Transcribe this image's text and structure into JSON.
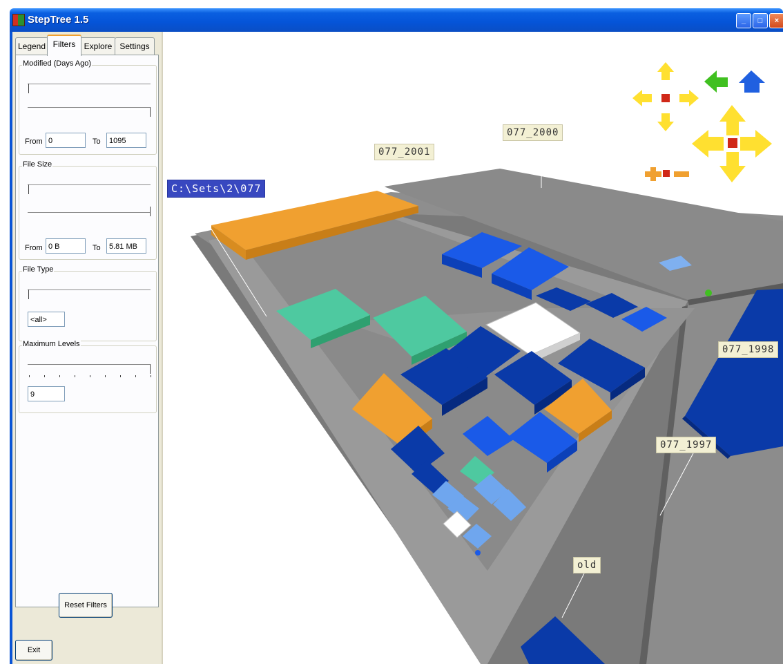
{
  "window": {
    "title": "StepTree 1.5",
    "buttons": [
      "minimize",
      "maximize",
      "close"
    ]
  },
  "tabs": [
    {
      "label": "Legend",
      "active": false
    },
    {
      "label": "Filters",
      "active": true
    },
    {
      "label": "Explore",
      "active": false
    },
    {
      "label": "Settings",
      "active": false
    }
  ],
  "filters": {
    "modified": {
      "label": "Modified (Days Ago)",
      "from_label": "From",
      "from_value": "0",
      "to_label": "To",
      "to_value": "1095"
    },
    "file_size": {
      "label": "File Size",
      "from_label": "From",
      "from_value": "0 B",
      "to_label": "To",
      "to_value": "5.81 MB"
    },
    "file_type": {
      "label": "File Type",
      "value": "<all>"
    },
    "max_levels": {
      "label": "Maximum Levels",
      "value": "9"
    },
    "reset_label": "Reset Filters"
  },
  "exit_label": "Exit",
  "view": {
    "labels": {
      "root": "C:\\Sets\\2\\077",
      "y2001": "077_2001",
      "y2000": "077_2000",
      "y1998": "077_1998",
      "y1997": "077_1997",
      "old": "old"
    },
    "nav_icons": [
      "rotate-up-arrow-icon",
      "rotate-left-arrow-icon",
      "rotate-right-arrow-icon",
      "rotate-down-arrow-icon",
      "back-arrow-icon",
      "home-up-arrow-icon",
      "pan-up-arrow-icon",
      "pan-left-arrow-icon",
      "pan-right-arrow-icon",
      "pan-down-arrow-icon",
      "zoom-in-icon",
      "zoom-out-icon"
    ],
    "colors": {
      "orange": "#f0a030",
      "dark_blue": "#0a3aa8",
      "blue": "#1a5ae8",
      "light_blue": "#6fa6ee",
      "teal": "#4ec9a0",
      "white": "#ffffff",
      "floor": "#808080",
      "nav_yellow": "#ffe030",
      "nav_green": "#40c020",
      "nav_blue": "#2060e0"
    }
  }
}
